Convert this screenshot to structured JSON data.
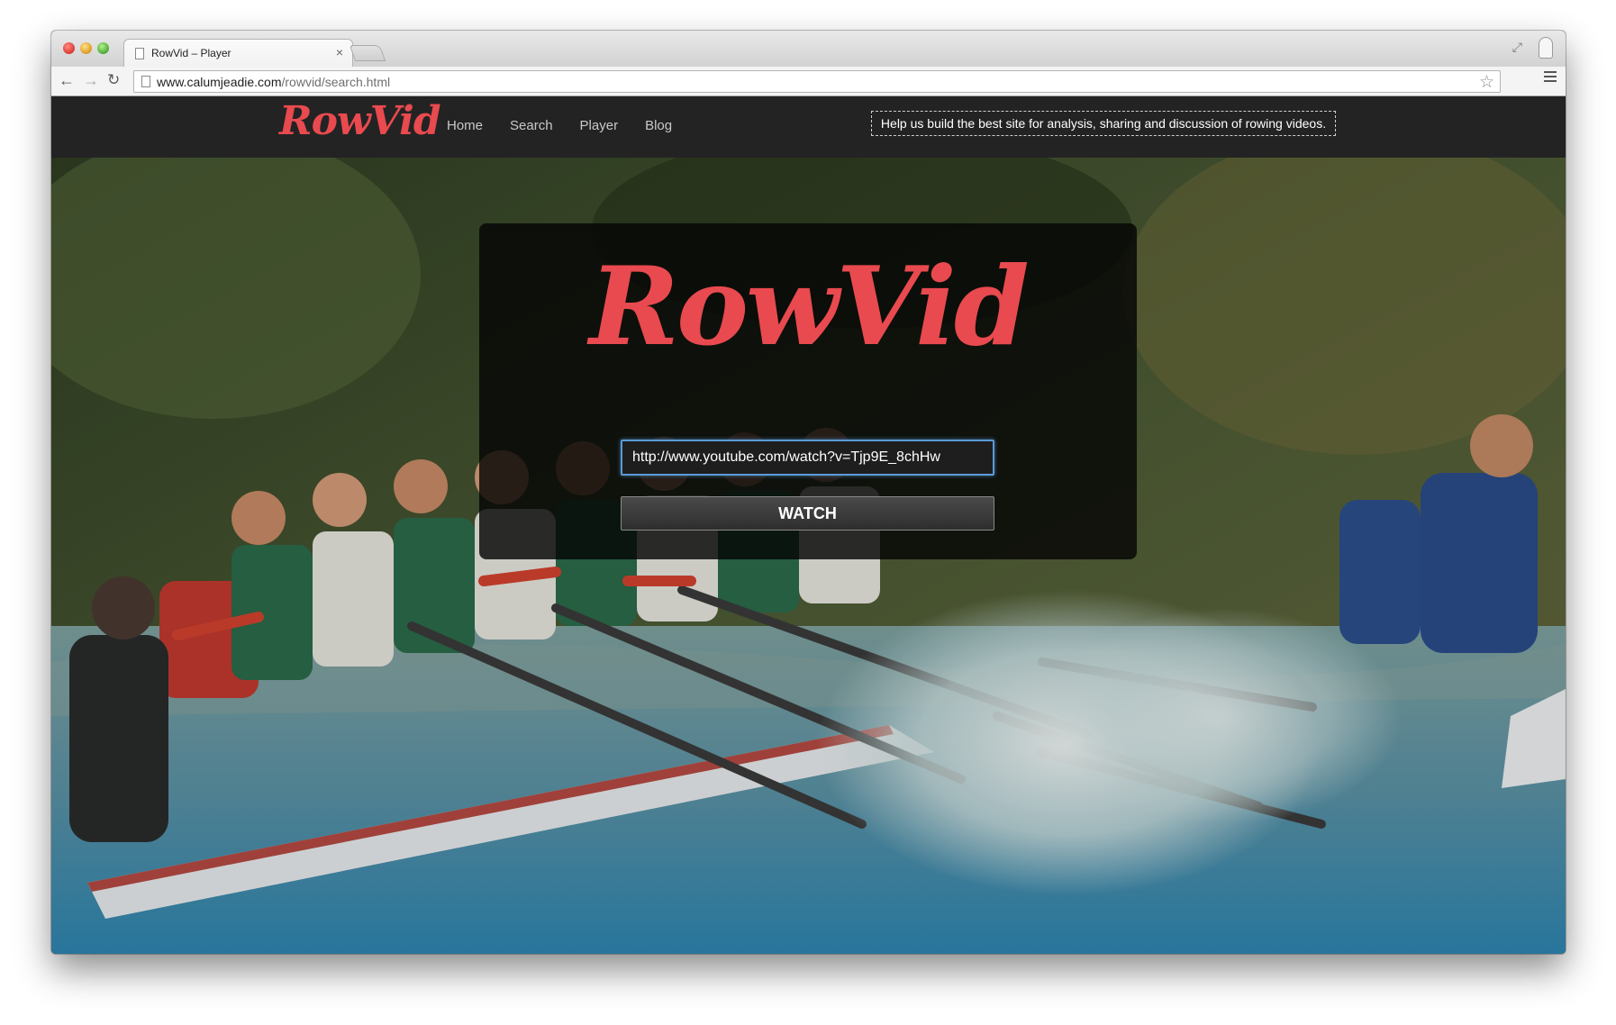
{
  "browser": {
    "tab_title": "RowVid – Player",
    "tab_close_glyph": "×",
    "url_domain": "www.calumjeadie.com",
    "url_path": "/rowvid/search.html",
    "icons": [
      "back-arrow-icon",
      "forward-arrow-icon",
      "reload-icon",
      "page-icon",
      "bookmark-star-icon",
      "menu-icon",
      "fullscreen-icon",
      "profile-icon"
    ]
  },
  "navbar": {
    "brand": "RowVid",
    "links": [
      "Home",
      "Search",
      "Player",
      "Blog"
    ],
    "notice": "Help us build the best site for analysis, sharing and discussion of rowing videos."
  },
  "hero": {
    "logo": "RowVid",
    "url_value": "http://www.youtube.com/watch?v=Tjp9E_8chHw",
    "watch_label": "WATCH"
  },
  "colors": {
    "brand_red": "#e84a4f",
    "navbar_bg": "#232323",
    "input_focus_blue": "#5a9ad6"
  }
}
